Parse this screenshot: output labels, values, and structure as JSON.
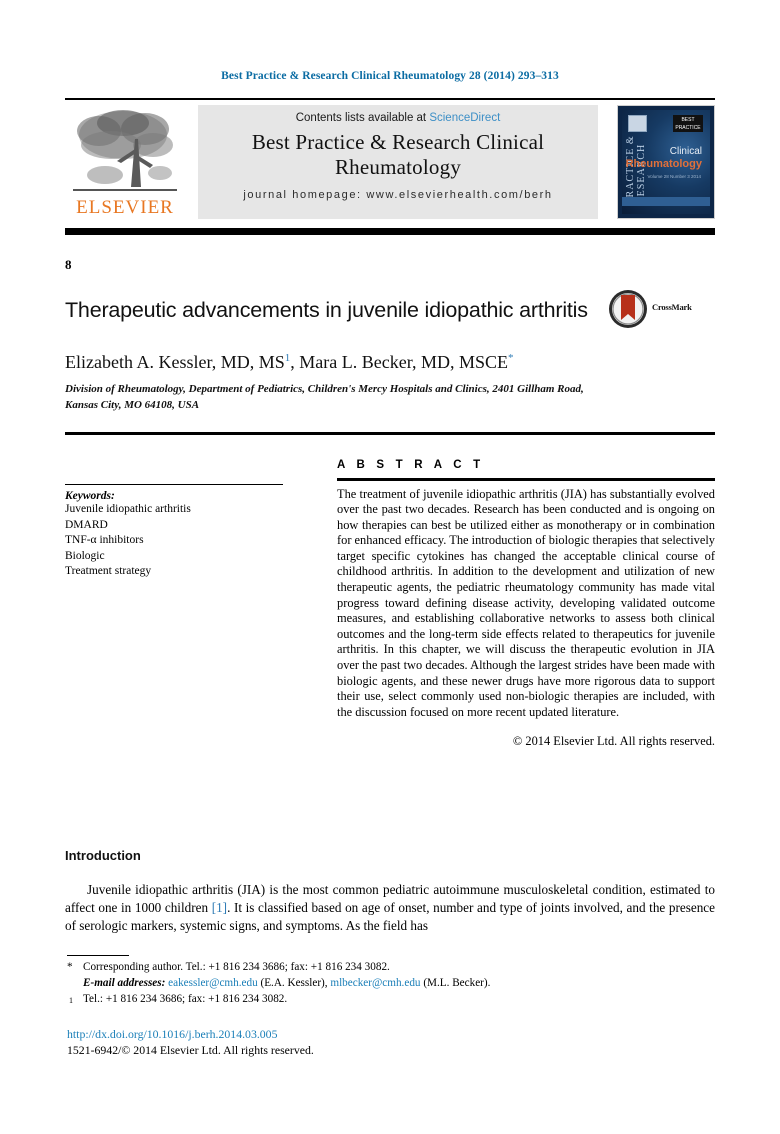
{
  "running_head": "Best Practice & Research Clinical Rheumatology 28 (2014) 293–313",
  "header": {
    "contents_prefix": "Contents lists available at ",
    "sciencedirect": "ScienceDirect",
    "journal_title": "Best Practice & Research Clinical Rheumatology",
    "homepage": "journal homepage: www.elsevierhealth.com/berh",
    "publisher_logo_word": "ELSEVIER",
    "cover": {
      "vertical_text": "PRACTICE & RESEARCH",
      "badge_text": "BEST PRACTICE",
      "line1": "Clinical",
      "line2": "Rheumatology",
      "line3": "Volume 28 Number 3 2014"
    }
  },
  "article": {
    "chapter_number": "8",
    "title": "Therapeutic advancements in juvenile idiopathic arthritis",
    "crossmark_label": "CrossMark",
    "authors": "Elizabeth A. Kessler, MD, MS",
    "author1_sup": "1",
    "authors_cont": ", Mara L. Becker, MD, MSCE",
    "author2_sup": "*",
    "affiliation": "Division of Rheumatology, Department of Pediatrics, Children's Mercy Hospitals and Clinics, 2401 Gillham Road, Kansas City, MO 64108, USA"
  },
  "keywords": {
    "label": "Keywords:",
    "items": [
      "Juvenile idiopathic arthritis",
      "DMARD",
      "TNF-α inhibitors",
      "Biologic",
      "Treatment strategy"
    ]
  },
  "abstract": {
    "heading": "A B S T R A C T",
    "body": "The treatment of juvenile idiopathic arthritis (JIA) has substantially evolved over the past two decades. Research has been conducted and is ongoing on how therapies can best be utilized either as monotherapy or in combination for enhanced efficacy. The introduction of biologic therapies that selectively target specific cytokines has changed the acceptable clinical course of childhood arthritis. In addition to the development and utilization of new therapeutic agents, the pediatric rheumatology community has made vital progress toward defining disease activity, developing validated outcome measures, and establishing collaborative networks to assess both clinical outcomes and the long-term side effects related to therapeutics for juvenile arthritis. In this chapter, we will discuss the therapeutic evolution in JIA over the past two decades. Although the largest strides have been made with biologic agents, and these newer drugs have more rigorous data to support their use, select commonly used non-biologic therapies are included, with the discussion focused on more recent updated literature.",
    "copyright": "© 2014 Elsevier Ltd. All rights reserved."
  },
  "introduction": {
    "heading": "Introduction",
    "paragraph_part1": "Juvenile idiopathic arthritis (JIA) is the most common pediatric autoimmune musculoskeletal condition, estimated to affect one in 1000 children ",
    "citation": "[1]",
    "paragraph_part2": ". It is classified based on age of onset, number and type of joints involved, and the presence of serologic markers, systemic signs, and symptoms. As the field has"
  },
  "footnotes": {
    "corresponding_mark": "*",
    "corresponding": "Corresponding author. Tel.: +1 816 234 3686; fax: +1 816 234 3082.",
    "email_label": "E-mail addresses:",
    "email1": "eakessler@cmh.edu",
    "email1_owner": "(E.A. Kessler),",
    "email2": "mlbecker@cmh.edu",
    "email2_owner": "(M.L. Becker).",
    "note1_mark": "1",
    "note1": "Tel.: +1 816 234 3686; fax: +1 816 234 3082."
  },
  "footer": {
    "doi": "http://dx.doi.org/10.1016/j.berh.2014.03.005",
    "issn_copyright": "1521-6942/© 2014 Elsevier Ltd. All rights reserved."
  },
  "colors": {
    "link_blue": "#1b7fb8",
    "header_blue": "#0b6ca3",
    "sciencedirect_blue": "#3d8fc6",
    "elsevier_orange": "#E87722",
    "cover_navy": "#0d2647",
    "crossmark_red": "#b7301a"
  }
}
